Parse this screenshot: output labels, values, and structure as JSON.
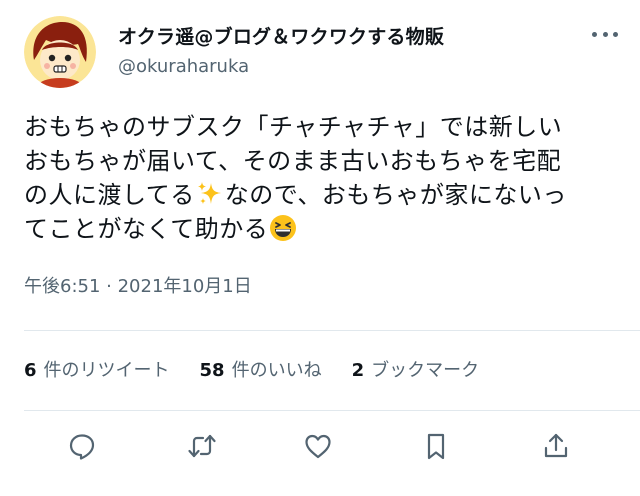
{
  "user": {
    "display_name": "オクラ遥@ブログ＆ワクワクする物販",
    "handle": "@okuraharuka",
    "avatar_icon": "cartoon-face-avatar"
  },
  "more_icon": "ellipsis-icon",
  "tweet": {
    "lines": [
      "おもちゃのサブスク「チャチャチャ」では新しい",
      "おもちゃが届いて、そのまま古いおもちゃを宅配",
      "の人に渡してる",
      "なので、おもちゃが家にないっ",
      "てことがなくて助かる"
    ],
    "emojis": [
      "sparkles",
      "grinning-squinting-face"
    ]
  },
  "timestamp": "午後6:51 · 2021年10月1日",
  "stats": {
    "retweets": {
      "count": "6",
      "label": "件のリツイート"
    },
    "likes": {
      "count": "58",
      "label": "件のいいね"
    },
    "bookmarks": {
      "count": "2",
      "label": "ブックマーク"
    }
  },
  "actions": [
    "reply-icon",
    "retweet-icon",
    "like-icon",
    "bookmark-icon",
    "share-icon"
  ],
  "colors": {
    "text": "#0f1419",
    "secondary": "#536471",
    "divider": "#e1e8ed",
    "avatar_bg": "#fbe596",
    "avatar_ring": "#c63c1e"
  }
}
